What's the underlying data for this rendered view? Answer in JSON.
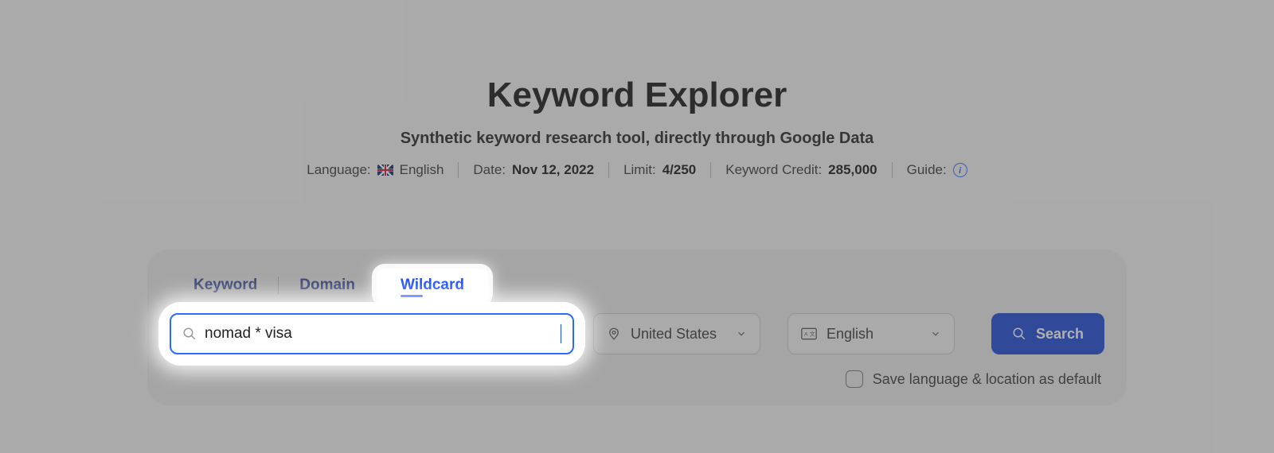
{
  "header": {
    "title": "Keyword Explorer",
    "subtitle": "Synthetic keyword research tool, directly through Google Data"
  },
  "meta": {
    "language_label": "Language:",
    "language_value": "English",
    "date_label": "Date:",
    "date_value": "Nov 12, 2022",
    "limit_label": "Limit:",
    "limit_value": "4/250",
    "credit_label": "Keyword Credit:",
    "credit_value": "285,000",
    "guide_label": "Guide:"
  },
  "tabs": {
    "items": [
      "Keyword",
      "Domain",
      "Wildcard"
    ],
    "active_index": 2
  },
  "search": {
    "value": "nomad * visa",
    "placeholder": ""
  },
  "country_select": {
    "value": "United States"
  },
  "language_select": {
    "value": "English"
  },
  "search_button": {
    "label": "Search"
  },
  "save_default": {
    "label": "Save language & location as default",
    "checked": false
  }
}
